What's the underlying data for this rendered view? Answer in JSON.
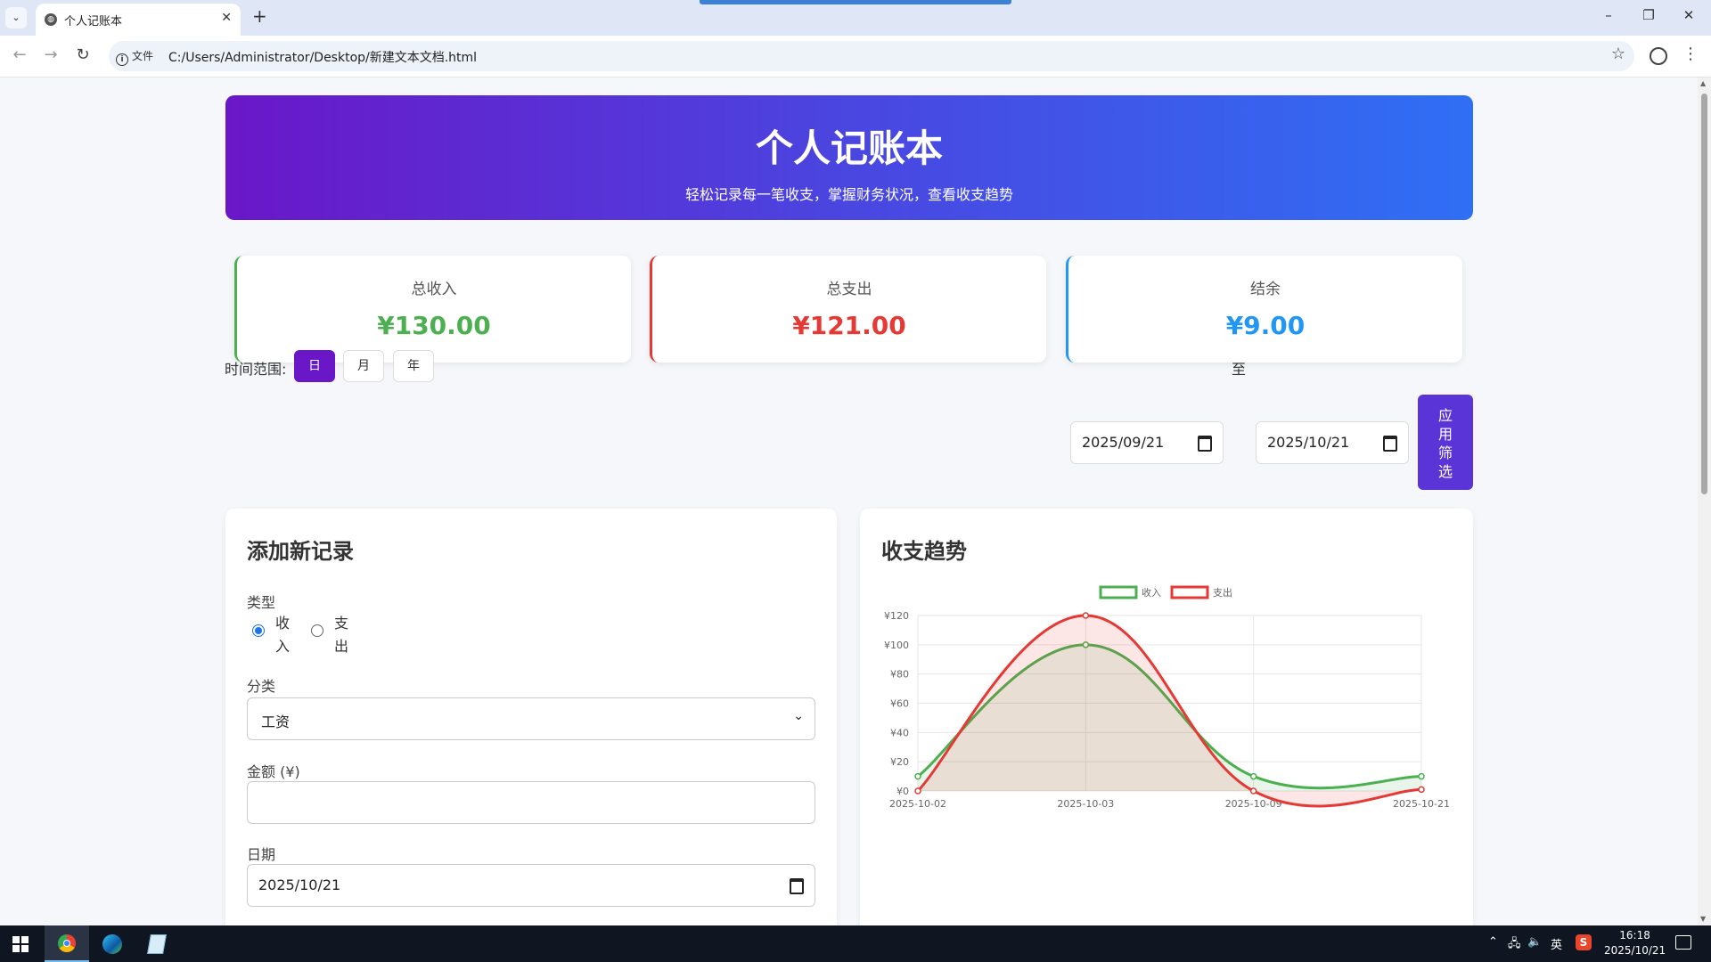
{
  "browser": {
    "tab_title": "个人记账本",
    "url_chip": "文件",
    "url": "C:/Users/Administrator/Desktop/新建文本文档.html"
  },
  "header": {
    "title": "个人记账本",
    "subtitle": "轻松记录每一笔收支，掌握财务状况，查看收支趋势"
  },
  "stats": {
    "income_label": "总收入",
    "income_value": "¥130.00",
    "expense_label": "总支出",
    "expense_value": "¥121.00",
    "balance_label": "结余",
    "balance_value": "¥9.00",
    "colors": {
      "income": "#4caf50",
      "expense": "#e53935",
      "balance": "#2196f3"
    }
  },
  "filter": {
    "label": "时间范围:",
    "options": [
      "日",
      "月",
      "年"
    ],
    "active": "日",
    "start_date": "2025/09/21",
    "to_label": "至",
    "end_date": "2025/10/21",
    "apply_label": "应用筛选"
  },
  "form": {
    "title": "添加新记录",
    "type_label": "类型",
    "type_income": "收入",
    "type_expense": "支出",
    "type_selected": "收入",
    "category_label": "分类",
    "category_value": "工资",
    "amount_label": "金额 (¥)",
    "amount_value": "",
    "date_label": "日期",
    "date_value": "2025/10/21"
  },
  "chart_panel": {
    "title": "收支趋势"
  },
  "chart_data": {
    "type": "line",
    "x": [
      "2025-10-02",
      "2025-10-03",
      "2025-10-09",
      "2025-10-21"
    ],
    "series": [
      {
        "name": "收入",
        "values": [
          10,
          100,
          10,
          10
        ],
        "color": "#4caf50"
      },
      {
        "name": "支出",
        "values": [
          0,
          120,
          0,
          1
        ],
        "color": "#e53935"
      }
    ],
    "y_ticks": [
      "¥0",
      "¥20",
      "¥40",
      "¥60",
      "¥80",
      "¥100",
      "¥120"
    ],
    "ylim": [
      0,
      120
    ],
    "grid": true,
    "legend": "top-center"
  },
  "taskbar": {
    "ime": "英",
    "time": "16:18",
    "date": "2025/10/21"
  }
}
